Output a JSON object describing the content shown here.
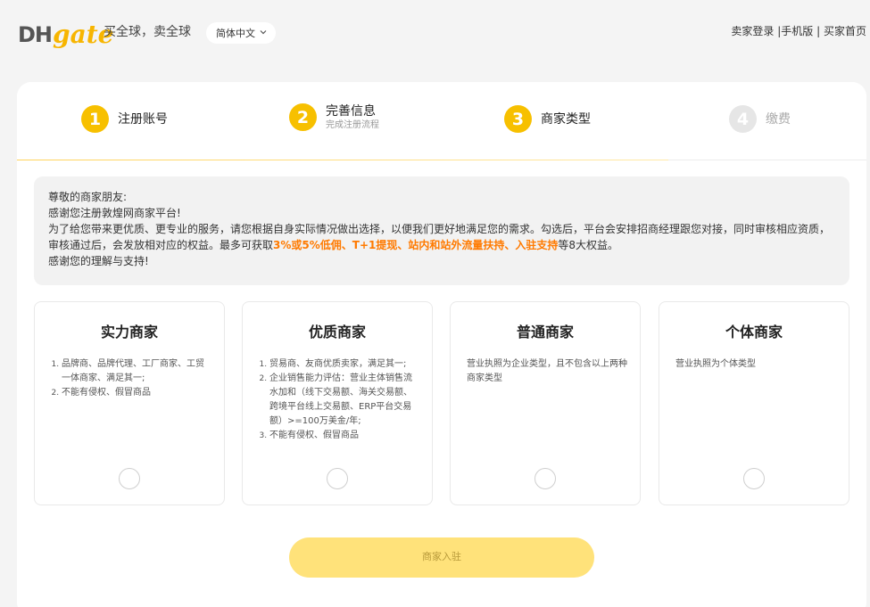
{
  "header": {
    "logo_dh": "DH",
    "logo_gate": "gate",
    "slogan": "买全球，卖全球",
    "language": "简体中文",
    "links": [
      "卖家登录",
      "手机版",
      "买家首页"
    ],
    "link_separator": " |",
    "link_separator2": " | "
  },
  "steps": [
    {
      "number": "1",
      "title": "注册账号",
      "subtitle": ""
    },
    {
      "number": "2",
      "title": "完善信息",
      "subtitle": "完成注册流程"
    },
    {
      "number": "3",
      "title": "商家类型",
      "subtitle": ""
    },
    {
      "number": "4",
      "title": "缴费",
      "subtitle": ""
    }
  ],
  "notice": {
    "line1": "尊敬的商家朋友:",
    "line2": "感谢您注册敦煌网商家平台!",
    "line3a": "为了给您带来更优质、更专业的服务，请您根据自身实际情况做出选择，以便我们更好地满足您的需求。勾选后，平台会安排招商经理跟您对接，同时审核相应资质，审核通过后，会发放相对应的权益。最多可获取",
    "highlight": "3%或5%低佣、T+1提现、站内和站外流量扶持、入驻支持",
    "line3b": "等8大权益。",
    "line4": "感谢您的理解与支持!"
  },
  "merchant_types": [
    {
      "name": "实力商家",
      "items": [
        "品牌商、品牌代理、工厂商家、工贸一体商家、满足其一;",
        "不能有侵权、假冒商品"
      ]
    },
    {
      "name": "优质商家",
      "items": [
        "贸易商、友商优质卖家，满足其一;",
        "企业销售能力评估：营业主体销售流水加和（线下交易额、海关交易额、跨境平台线上交易额、ERP平台交易额）>=100万美金/年;",
        "不能有侵权、假冒商品"
      ]
    },
    {
      "name": "普通商家",
      "desc": "营业执照为企业类型，且不包含以上两种商家类型"
    },
    {
      "name": "个体商家",
      "desc": "营业执照为个体类型"
    }
  ],
  "submit_label": "商家入驻",
  "colors": {
    "accent": "#f7c000",
    "highlight": "#ff7a00",
    "button": "#ffe27a"
  }
}
